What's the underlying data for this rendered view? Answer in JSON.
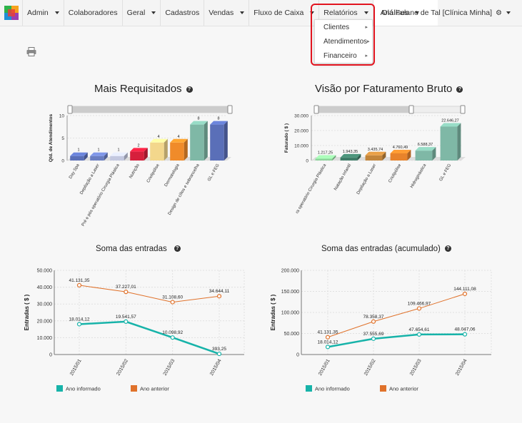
{
  "nav": {
    "items": [
      {
        "label": "Admin",
        "caret": true
      },
      {
        "label": "Colaboradores",
        "caret": false
      },
      {
        "label": "Geral",
        "caret": true
      },
      {
        "label": "Cadastros",
        "caret": false
      },
      {
        "label": "Vendas",
        "caret": true
      },
      {
        "label": "Fluxo de Caixa",
        "caret": true
      },
      {
        "label": "Relatórios",
        "caret": true
      },
      {
        "label": "Análises",
        "caret": true
      }
    ],
    "user": "Olá Fulano de Tal [Clínica Minha]",
    "user_icon": "gear-icon"
  },
  "dropdown": {
    "items": [
      {
        "label": "Clientes"
      },
      {
        "label": "Atendimentos"
      },
      {
        "label": "Financeiro"
      }
    ]
  },
  "colors": {
    "highlight": "#e2141f",
    "teal": "#17b3a9",
    "orange": "#e0722b"
  },
  "chart_data": [
    {
      "type": "bar",
      "title": "Mais Requisitados",
      "ylabel": "Qtd. de Atendimentos",
      "ylim": [
        0,
        10
      ],
      "yticks": [
        "0",
        "5",
        "10"
      ],
      "categories": [
        "Day Spa",
        "Depilação a Laser",
        "Pré e pós operatório Cirurgia Plástica",
        "Nutrição",
        "Criolipólise",
        "Dermatologia",
        "Design de cílios e sobrancelha",
        "GL e FEG"
      ],
      "values": [
        1,
        1,
        1,
        2,
        4,
        4,
        8,
        8
      ],
      "value_labels": [
        "1",
        "1",
        "1",
        "2",
        "4",
        "4",
        "8",
        "8"
      ],
      "bar_colors": [
        "#5a6fb8",
        "#6a7ec2",
        "#c3c8e0",
        "#d61f3c",
        "#f3d78c",
        "#f08b2a",
        "#7fb8a6",
        "#5a6fb8"
      ]
    },
    {
      "type": "bar",
      "title": "Visão por Faturamento Bruto",
      "ylabel": "Faturado ( $ )",
      "ylim": [
        0,
        30000
      ],
      "yticks": [
        "0",
        "10.000",
        "20.000",
        "30.000"
      ],
      "categories": [
        "ra operatório Cirurgia Plástica",
        "Natação Infantil",
        "Depilação a Laser",
        "Criolipólise",
        "Hidroginástica",
        "GL e FEG"
      ],
      "values": [
        1217.25,
        1943.35,
        3435.74,
        4760.49,
        6588.37,
        22646.27
      ],
      "value_labels": [
        "1.217,25",
        "1.943,35",
        "3.435,74",
        "4.760,49",
        "6.588,37",
        "22.646,27"
      ],
      "bar_colors": [
        "#8fd49c",
        "#3f7d68",
        "#c2853b",
        "#e8832b",
        "#7fb8a6",
        "#7fb8a6"
      ]
    },
    {
      "type": "line",
      "title": "Soma das entradas",
      "ylabel": "Entradas ( $ )",
      "ylim": [
        0,
        50000
      ],
      "yticks": [
        "0",
        "10.000",
        "20.000",
        "30.000",
        "40.000",
        "50.000"
      ],
      "x": [
        "2015/01",
        "2015/02",
        "2015/03",
        "2015/04"
      ],
      "series": [
        {
          "name": "Ano informado",
          "values": [
            18014.12,
            19541.57,
            10098.92,
            393.25
          ],
          "labels": [
            "18.014,12",
            "19.541,57",
            "10.098,92",
            "393,25"
          ],
          "color": "#17b3a9"
        },
        {
          "name": "Ano anterior",
          "values": [
            41131.35,
            37227.01,
            31108.6,
            34644.11
          ],
          "labels": [
            "41.131,35",
            "37.227,01",
            "31.108,60",
            "34.644,11"
          ],
          "color": "#e0722b"
        }
      ]
    },
    {
      "type": "line",
      "title": "Soma das entradas (acumulado)",
      "ylabel": "Entradas ( $ )",
      "ylim": [
        0,
        200000
      ],
      "yticks": [
        "0",
        "50.000",
        "100.000",
        "150.000",
        "200.000"
      ],
      "x": [
        "2015/01",
        "2015/02",
        "2015/03",
        "2015/04"
      ],
      "series": [
        {
          "name": "Ano informado",
          "values": [
            18014.12,
            37555.69,
            47654.61,
            48047.06
          ],
          "labels": [
            "18.014,12",
            "37.555,69",
            "47.654,61",
            "48.047,06"
          ],
          "color": "#17b3a9"
        },
        {
          "name": "Ano anterior",
          "values": [
            41131.35,
            78358.37,
            109466.97,
            144111.08
          ],
          "labels": [
            "41.131,35",
            "78.358,37",
            "109.466,97",
            "144.111,08"
          ],
          "color": "#e0722b"
        }
      ]
    }
  ]
}
